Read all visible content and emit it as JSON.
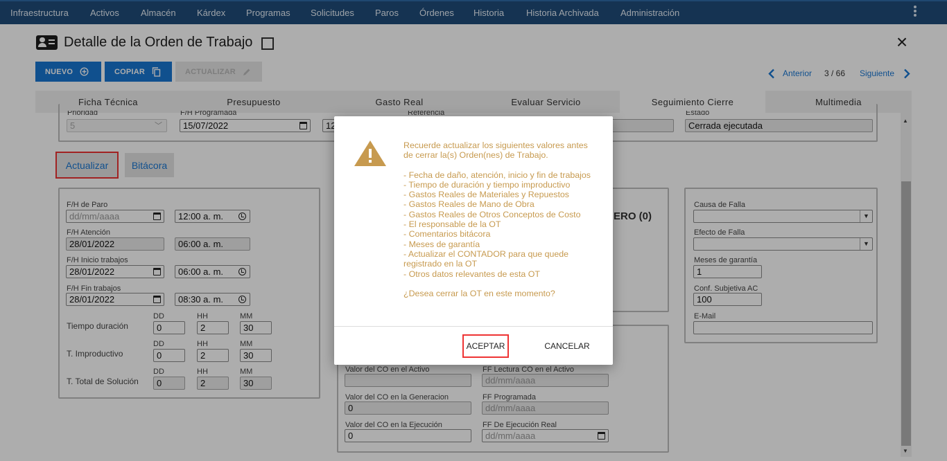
{
  "nav": {
    "items": [
      "Infraestructura",
      "Activos",
      "Almacén",
      "Kárdex",
      "Programas",
      "Solicitudes",
      "Paros",
      "Órdenes",
      "Historia",
      "Historia Archivada",
      "Administración"
    ],
    "menu_icon": "more-vertical-icon"
  },
  "header": {
    "title": "Detalle de la Orden de Trabajo",
    "title_icon": "id-card-icon",
    "close_icon": "close-icon"
  },
  "toolbar": {
    "nuevo_label": "NUEVO",
    "copiar_label": "COPIAR",
    "actualizar_label": "ACTUALIZAR"
  },
  "pager": {
    "prev_label": "Anterior",
    "position": "3 / 66",
    "next_label": "Siguiente"
  },
  "tabs": [
    {
      "label": "Ficha Técnica"
    },
    {
      "label": "Presupuesto"
    },
    {
      "label": "Gasto Real"
    },
    {
      "label": "Evaluar Servicio"
    },
    {
      "label": "Seguimiento Cierre",
      "active": true
    },
    {
      "label": "Multimedia"
    }
  ],
  "top_row": {
    "prioridad_label": "Prioridad",
    "prioridad_value": "5",
    "fh_programada_label": "F/H Programada",
    "fh_programada_value": "15/07/2022",
    "referencia_label": "Referencia",
    "referencia_value": "12",
    "estado_label": "Estado",
    "estado_value": "Cerrada ejecutada"
  },
  "section_buttons": {
    "actualizar": "Actualizar",
    "bitacora": "Bitácora"
  },
  "dates": {
    "paro_label": "F/H de Paro",
    "paro_date": "dd/mm/aaaa",
    "paro_time": "12:00 a. m.",
    "atencion_label": "F/H Atención",
    "atencion_date": "28/01/2022",
    "atencion_time": "06:00 a. m.",
    "inicio_label": "F/H Inicio trabajos",
    "inicio_date": "28/01/2022",
    "inicio_time": "06:00 a. m.",
    "fin_label": "F/H Fin trabajos",
    "fin_date": "28/01/2022",
    "fin_time": "08:30 a. m."
  },
  "durations": {
    "headers": [
      "DD",
      "HH",
      "MM"
    ],
    "rows": [
      {
        "label": "Tiempo duración",
        "dd": "0",
        "hh": "2",
        "mm": "30"
      },
      {
        "label": "T. Improductivo",
        "dd": "0",
        "hh": "2",
        "mm": "30"
      },
      {
        "label": "T. Total de Solución",
        "dd": "0",
        "hh": "2",
        "mm": "30"
      }
    ]
  },
  "middle": {
    "partial_text": "ERO (0)",
    "valor_co_activo_label": "Valor del CO en el Activo",
    "valor_co_activo_value": "",
    "ff_lectura_label": "FF Lectura CO en el Activo",
    "ff_lectura_value": "dd/mm/aaaa",
    "valor_co_generacion_label": "Valor del CO en la Generacion",
    "valor_co_generacion_value": "0",
    "ff_programada_label": "FF Programada",
    "ff_programada_value": "dd/mm/aaaa",
    "valor_co_ejecucion_label": "Valor del CO en la Ejecución",
    "valor_co_ejecucion_value": "0",
    "ff_ejecucion_label": "FF De Ejecución Real",
    "ff_ejecucion_value": "dd/mm/aaaa"
  },
  "right_panel": {
    "causa_label": "Causa de Falla",
    "causa_value": "",
    "efecto_label": "Efecto de Falla",
    "efecto_value": "",
    "meses_label": "Meses de garantía",
    "meses_value": "1",
    "conf_label": "Conf. Subjetiva AC",
    "conf_value": "100",
    "email_label": "E-Mail",
    "email_value": ""
  },
  "dialog": {
    "icon": "warning-icon",
    "message": "Recuerde actualizar los siguientes valores antes de cerrar la(s) Orden(nes) de Trabajo.",
    "items": "- Fecha de daño, atención, inicio y fin de trabajos\n- Tiempo de duración y tiempo improductivo\n- Gastos Reales de Materiales y Repuestos\n- Gastos Reales de Mano de Obra\n- Gastos Reales de Otros Conceptos de Costo\n- El responsable de la OT\n- Comentarios bitácora\n- Meses de garantía\n- Actualizar el CONTADOR para que quede registrado en la OT\n- Otros datos relevantes de esta OT",
    "question": "¿Desea cerrar la OT en este momento?",
    "accept_label": "ACEPTAR",
    "cancel_label": "CANCELAR",
    "colors": {
      "message": "#c79a4f",
      "icon": "#c79a4f"
    }
  },
  "colors": {
    "nav_bg": "#1f4c79",
    "primary": "#1976d2",
    "highlight": "#e33333"
  }
}
